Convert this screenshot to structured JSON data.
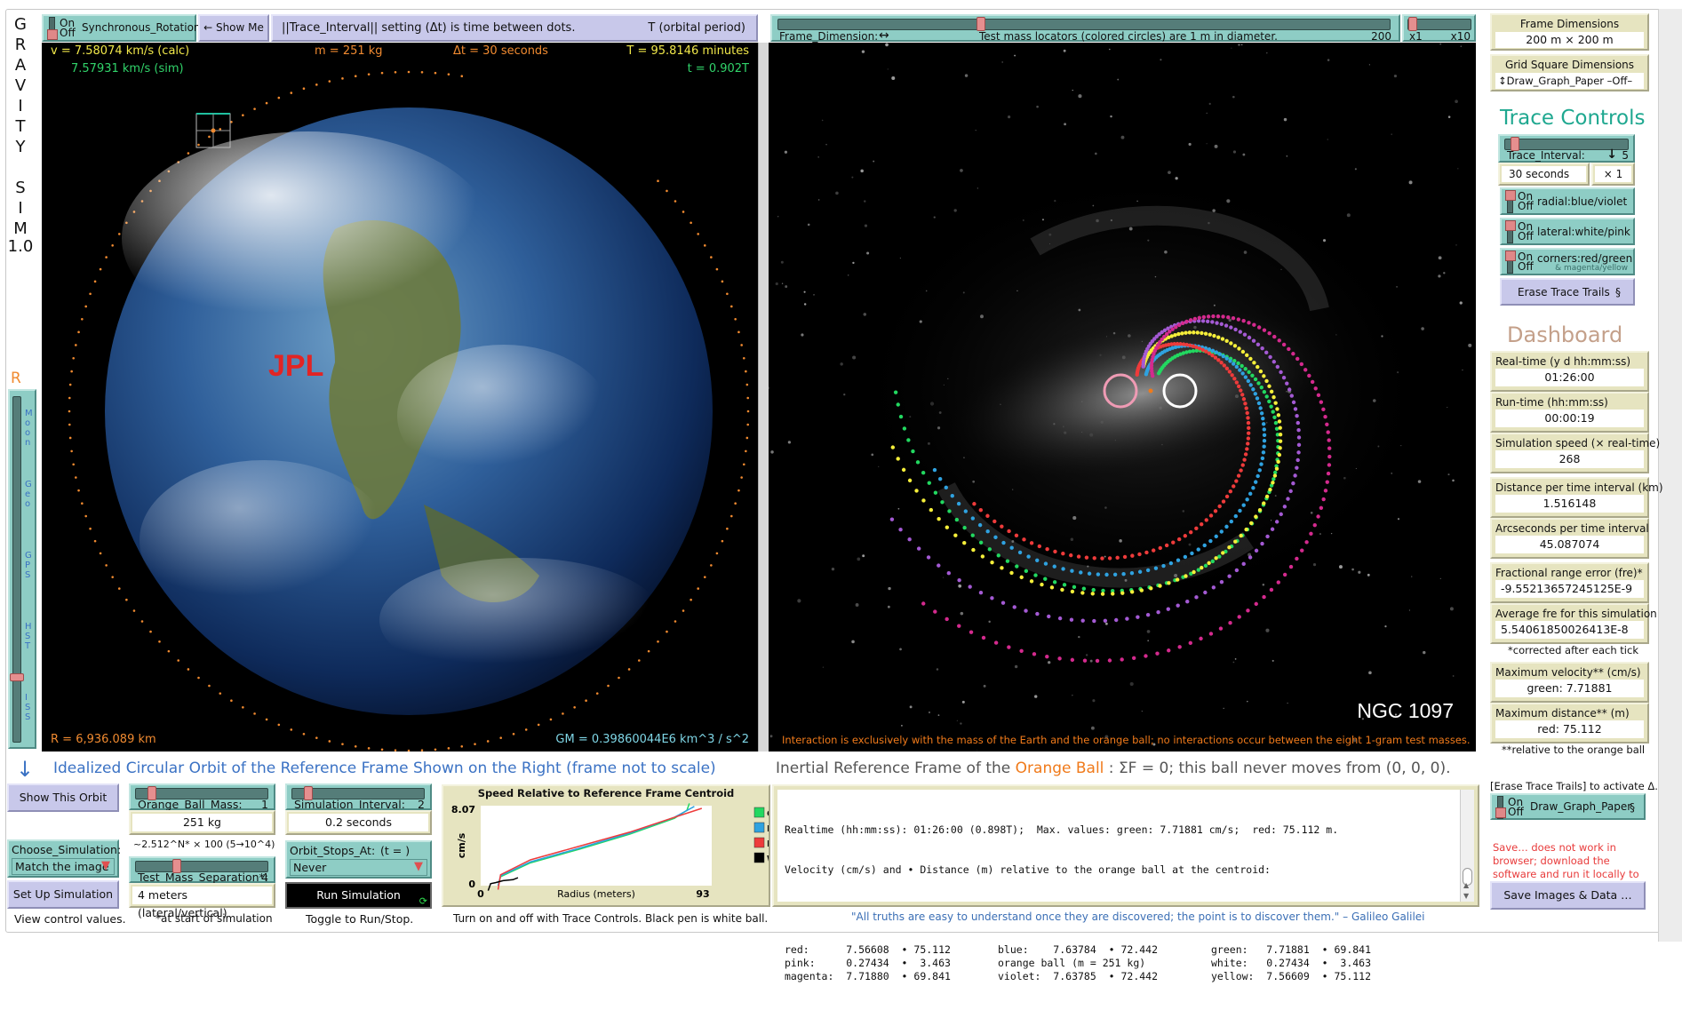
{
  "app": {
    "vertical_title": [
      "G",
      "R",
      "A",
      "V",
      "I",
      "T",
      "Y",
      "",
      "S",
      "I",
      "M"
    ],
    "version": "1.0"
  },
  "top_bar": {
    "sync_switch": {
      "on": "On",
      "off": "Off",
      "label": "Synchronous_Rotation",
      "state": "off"
    },
    "show_me": "← Show Me",
    "trace_note": "||Trace_Interval|| setting (Δt) is time between dots.",
    "period_label": "T (orbital period)",
    "frame_dimension": {
      "label": "Frame_Dimension:",
      "arrow": "↔",
      "note": "Test mass locators (colored circles) are 1 m in diameter.",
      "value": "200",
      "fraction": 0.33
    },
    "zoom_slider": {
      "min_label": "x1",
      "max_label": "x10",
      "fraction": 0.02
    }
  },
  "earth_panel": {
    "v_calc": "v = 7.58074 km/s (calc)",
    "v_sim": "7.57931 km/s (sim)",
    "mass": "m = 251 kg",
    "dt": "Δt = 30 seconds",
    "period": "T = 95.8146 minutes",
    "t_frac": "t = 0.902T",
    "radius": "R = 6,936.089 km",
    "gm": "GM = 0.39860044E6  km^3 / s^2",
    "logo": "JPL",
    "orbit_progress": 0.902,
    "colors": {
      "yellow": "#f1e84a",
      "green": "#31d36a",
      "orange": "#f08a30",
      "cyan": "#7fd6e6"
    }
  },
  "r_slider": {
    "label": "R",
    "ticks": [
      "Moon",
      "Geo",
      "GPS",
      "HST",
      "ISS"
    ],
    "fraction": 0.18
  },
  "galaxy_panel": {
    "name": "NGC 1097",
    "interaction_note": "Interaction is exclusively with the mass of the Earth and the orange ball; no interactions occur between the eight 1-gram test masses.",
    "trail_colors": {
      "red": "#ee3b3b",
      "green": "#22d860",
      "blue": "#2fa2e0",
      "yellow": "#f5ef3a",
      "magenta": "#d42a8e",
      "violet": "#a45ad4",
      "pink": "#ef9bb4",
      "white": "#ffffff",
      "orange": "#f07a1a"
    }
  },
  "headings": {
    "left": "Idealized Circular Orbit of the Reference Frame Shown on the Right (frame not to scale)",
    "right_prefix": "Inertial Reference Frame of the ",
    "right_highlight": "Orange Ball",
    "right_suffix": " : ΣF = 0; this ball never moves from (0, 0, 0)."
  },
  "controls": {
    "show_orbit": "Show This Orbit",
    "choose_sim_label": "Choose_Simulation:",
    "choose_sim_value": "Match the image",
    "setup": "Set Up Simulation",
    "setup_note": "View control values.",
    "orange_mass": {
      "label": "Orange_Ball_Mass:",
      "value": "1",
      "display": "251 kg",
      "note": "~2.512^N* × 100  (5→10^4)",
      "fraction": 0.1
    },
    "separation": {
      "label": "Test_Mass_Separation*:",
      "value": "4",
      "display": "4 meters (lateral/vertical)",
      "note": "*at start of simulation",
      "fraction": 0.3
    },
    "sim_interval": {
      "label": "Simulation_Interval:",
      "value": "2",
      "display": "0.2 seconds",
      "fraction": 0.1
    },
    "orbit_stops": {
      "label": "Orbit_Stops_At:",
      "suffix": "(t = )",
      "value": "Never"
    },
    "run": "Run Simulation",
    "run_note": "Toggle to Run/Stop."
  },
  "chart_data": {
    "type": "line",
    "title": "Speed Relative to Reference Frame Centroid",
    "xlabel": "Radius (meters)",
    "ylabel": "cm/s",
    "xlim": [
      0,
      93
    ],
    "ylim": [
      0,
      8.07
    ],
    "x_ticks": [
      "0",
      "93"
    ],
    "y_ticks": [
      "0",
      "8.07"
    ],
    "legend": [
      "G",
      "B",
      "R",
      "W"
    ],
    "legend_placement": "right",
    "series": [
      {
        "name": "G",
        "color": "#22d860",
        "points": [
          [
            7,
            0
          ],
          [
            8,
            0.9
          ],
          [
            20,
            2.3
          ],
          [
            40,
            3.7
          ],
          [
            60,
            5.2
          ],
          [
            78,
            6.8
          ],
          [
            83,
            7.6
          ],
          [
            84,
            8.3
          ]
        ]
      },
      {
        "name": "B",
        "color": "#2fa2e0",
        "points": [
          [
            7,
            0
          ],
          [
            8,
            1.0
          ],
          [
            20,
            2.4
          ],
          [
            40,
            3.8
          ],
          [
            60,
            5.3
          ],
          [
            78,
            6.9
          ],
          [
            86,
            8.0
          ]
        ]
      },
      {
        "name": "R",
        "color": "#ee3b3b",
        "points": [
          [
            7,
            -0.4
          ],
          [
            8,
            1.1
          ],
          [
            20,
            2.6
          ],
          [
            40,
            4.0
          ],
          [
            60,
            5.4
          ],
          [
            78,
            6.9
          ],
          [
            89,
            7.8
          ]
        ]
      },
      {
        "name": "W",
        "color": "#000000",
        "points": [
          [
            3,
            -0.5
          ],
          [
            4,
            0.2
          ],
          [
            6,
            0.3
          ],
          [
            9,
            0.5
          ],
          [
            13,
            0.6
          ],
          [
            15,
            0.8
          ]
        ]
      }
    ],
    "caption": "Turn on and off with Trace Controls. Black pen is white ball."
  },
  "output_log": {
    "line1": "Realtime (hh:mm:ss): 01:26:00 (0.898T);  Max. values: green: 7.71881 cm/s;  red: 75.112 m.",
    "line2": "Velocity (cm/s) and • Distance (m) relative to the orange ball at the centroid:",
    "rows": [
      [
        "red:      7.56608  • 75.112",
        "blue:    7.63784  • 72.442",
        "green:   7.71881  • 69.841"
      ],
      [
        "pink:     0.27434  •  3.463",
        "orange ball (m = 251 kg)",
        "white:   0.27434  •  3.463"
      ],
      [
        "magenta:  7.71880  • 69.841",
        "violet:  7.63785  • 72.442",
        "yellow:  7.56609  • 75.112"
      ]
    ],
    "quote": "\"All truths are easy to understand once they are discovered; the point is to discover them.\" – Galileo Galilei"
  },
  "sidebar": {
    "frame_dimensions": {
      "label": "Frame Dimensions",
      "value": "200 m × 200 m"
    },
    "grid_square": {
      "label": "Grid Square Dimensions",
      "value": "↕Draw_Graph_Paper –Off–"
    },
    "trace_title": "Trace Controls",
    "trace_interval": {
      "label": "Trace_Interval:",
      "arrow": "↓",
      "value": "5",
      "display": "30 seconds",
      "mult": "× 1",
      "fraction": 0.05
    },
    "switches": [
      {
        "label": "radial:blue/violet",
        "sub": "",
        "state": "on"
      },
      {
        "label": "lateral:white/pink",
        "sub": "",
        "state": "on"
      },
      {
        "label": "corners:red/green",
        "sub": "& magenta/yellow",
        "state": "on"
      }
    ],
    "erase": "Erase Trace Trails",
    "erase_sym": "§",
    "dashboard_title": "Dashboard",
    "dashboard": [
      {
        "label": "Real-time (y d hh:mm:ss)",
        "value": "01:26:00"
      },
      {
        "label": "Run-time (hh:mm:ss)",
        "value": "00:00:19"
      },
      {
        "label": "Simulation speed (× real-time)",
        "value": "268"
      },
      {
        "label": "Distance per time interval (km)",
        "value": "1.516148"
      },
      {
        "label": "Arcseconds per time interval",
        "value": "45.087074"
      },
      {
        "label": "Fractional range error (fre)*",
        "value": "-9.55213657245125E-9"
      },
      {
        "label": "Average fre for this simulation",
        "value": "5.54061850026413E-8"
      },
      {
        "label": "Maximum velocity** (cm/s)",
        "value": "green: 7.71881"
      },
      {
        "label": "Maximum distance** (m)",
        "value": "red: 75.112"
      }
    ],
    "corrected_note": "*corrected after each tick",
    "relative_note": "**relative to the orange ball",
    "erase_hint": "[Erase Trace Trails] to activate Δ.",
    "graph_paper": {
      "on": "On",
      "off": "Off",
      "label": "Draw_Graph_Paper",
      "sym": "§",
      "state": "off"
    },
    "save_warning": "Save… does not work in browser; download the software and run it locally to save images and data.",
    "save_button": "Save Images & Data …"
  }
}
